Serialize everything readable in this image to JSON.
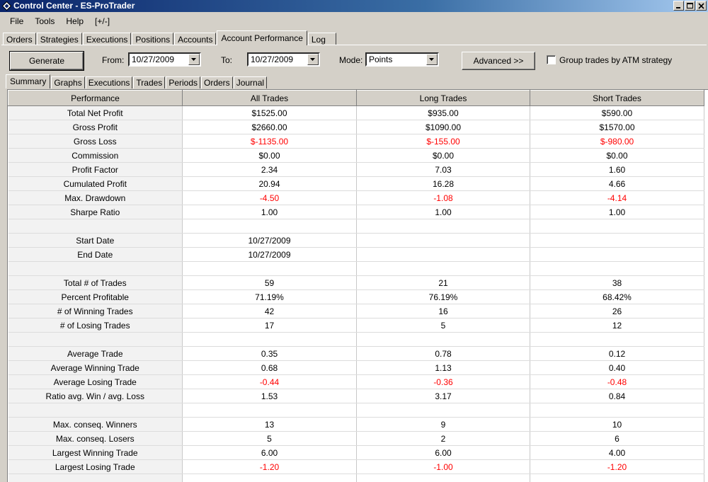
{
  "window": {
    "title": "Control Center - ES-ProTrader",
    "colors": {
      "title_bar": "#0a246a",
      "negative": "#ff0000",
      "face": "#d4d0c8"
    }
  },
  "menu": [
    "File",
    "Tools",
    "Help",
    "[+/-]"
  ],
  "tabs_top": [
    "Orders",
    "Strategies",
    "Executions",
    "Positions",
    "Accounts",
    "Account Performance",
    "Log"
  ],
  "tabs_top_active": "Account Performance",
  "toolbar": {
    "generate_label": "Generate",
    "from_label": "From:",
    "from_value": "10/27/2009",
    "to_label": "To:",
    "to_value": "10/27/2009",
    "mode_label": "Mode:",
    "mode_value": "Points",
    "advanced_label": "Advanced >>",
    "group_label": "Group trades by ATM strategy",
    "group_checked": false
  },
  "tabs_sub": [
    "Summary",
    "Graphs",
    "Executions",
    "Trades",
    "Periods",
    "Orders",
    "Journal"
  ],
  "tabs_sub_active": "Summary",
  "table": {
    "headers": [
      "Performance",
      "All Trades",
      "Long Trades",
      "Short Trades"
    ],
    "rows": [
      {
        "label": "Total Net Profit",
        "values": [
          "$1525.00",
          "$935.00",
          "$590.00"
        ],
        "neg": false
      },
      {
        "label": "Gross Profit",
        "values": [
          "$2660.00",
          "$1090.00",
          "$1570.00"
        ],
        "neg": false
      },
      {
        "label": "Gross Loss",
        "values": [
          "$-1135.00",
          "$-155.00",
          "$-980.00"
        ],
        "neg": true
      },
      {
        "label": "Commission",
        "values": [
          "$0.00",
          "$0.00",
          "$0.00"
        ],
        "neg": false
      },
      {
        "label": "Profit Factor",
        "values": [
          "2.34",
          "7.03",
          "1.60"
        ],
        "neg": false
      },
      {
        "label": "Cumulated Profit",
        "values": [
          "20.94",
          "16.28",
          "4.66"
        ],
        "neg": false
      },
      {
        "label": "Max. Drawdown",
        "values": [
          "-4.50",
          "-1.08",
          "-4.14"
        ],
        "neg": true
      },
      {
        "label": "Sharpe Ratio",
        "values": [
          "1.00",
          "1.00",
          "1.00"
        ],
        "neg": false
      },
      {
        "label": "",
        "values": [
          "",
          "",
          ""
        ],
        "neg": false
      },
      {
        "label": "Start Date",
        "values": [
          "10/27/2009",
          "",
          ""
        ],
        "neg": false
      },
      {
        "label": "End Date",
        "values": [
          "10/27/2009",
          "",
          ""
        ],
        "neg": false
      },
      {
        "label": "",
        "values": [
          "",
          "",
          ""
        ],
        "neg": false
      },
      {
        "label": "Total # of Trades",
        "values": [
          "59",
          "21",
          "38"
        ],
        "neg": false
      },
      {
        "label": "Percent Profitable",
        "values": [
          "71.19%",
          "76.19%",
          "68.42%"
        ],
        "neg": false
      },
      {
        "label": "# of Winning Trades",
        "values": [
          "42",
          "16",
          "26"
        ],
        "neg": false
      },
      {
        "label": "# of Losing Trades",
        "values": [
          "17",
          "5",
          "12"
        ],
        "neg": false
      },
      {
        "label": "",
        "values": [
          "",
          "",
          ""
        ],
        "neg": false
      },
      {
        "label": "Average Trade",
        "values": [
          "0.35",
          "0.78",
          "0.12"
        ],
        "neg": false
      },
      {
        "label": "Average Winning Trade",
        "values": [
          "0.68",
          "1.13",
          "0.40"
        ],
        "neg": false
      },
      {
        "label": "Average Losing Trade",
        "values": [
          "-0.44",
          "-0.36",
          "-0.48"
        ],
        "neg": true
      },
      {
        "label": "Ratio avg. Win / avg. Loss",
        "values": [
          "1.53",
          "3.17",
          "0.84"
        ],
        "neg": false
      },
      {
        "label": "",
        "values": [
          "",
          "",
          ""
        ],
        "neg": false
      },
      {
        "label": "Max. conseq. Winners",
        "values": [
          "13",
          "9",
          "10"
        ],
        "neg": false
      },
      {
        "label": "Max. conseq. Losers",
        "values": [
          "5",
          "2",
          "6"
        ],
        "neg": false
      },
      {
        "label": "Largest Winning Trade",
        "values": [
          "6.00",
          "6.00",
          "4.00"
        ],
        "neg": false
      },
      {
        "label": "Largest Losing Trade",
        "values": [
          "-1.20",
          "-1.00",
          "-1.20"
        ],
        "neg": true
      },
      {
        "label": "",
        "values": [
          "",
          "",
          ""
        ],
        "neg": false
      }
    ]
  }
}
